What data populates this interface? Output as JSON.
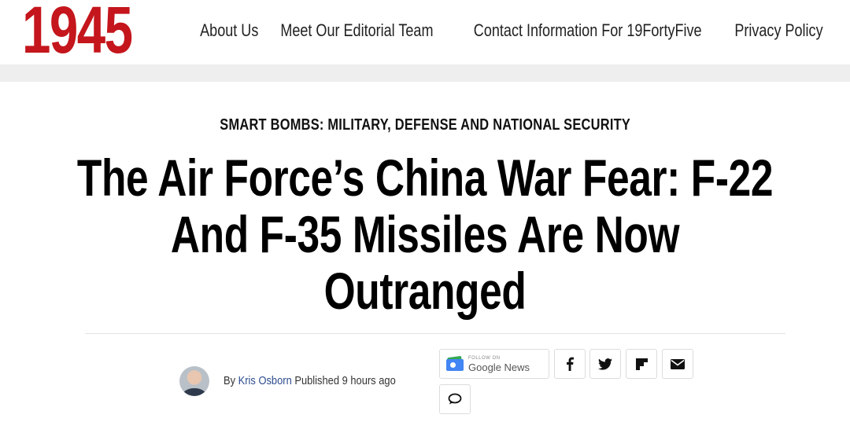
{
  "site": {
    "logo_text": "1945",
    "brand_color": "#c4161c"
  },
  "nav": {
    "items": [
      {
        "label": "About Us"
      },
      {
        "label": "Meet Our Editorial Team"
      },
      {
        "label": "Contact Information For 19FortyFive"
      },
      {
        "label": "Privacy Policy"
      }
    ]
  },
  "article": {
    "category": "SMART BOMBS: MILITARY, DEFENSE AND NATIONAL SECURITY",
    "title": "The Air Force’s China War Fear: F-22 And F-35 Missiles Are Now Outranged",
    "byline": {
      "prefix": "By",
      "author": "Kris Osborn",
      "published_label": "Published",
      "time_ago": "9 hours ago"
    }
  },
  "share": {
    "google_news": {
      "small_label": "FOLLOW ON",
      "label": "Google News"
    },
    "buttons": [
      {
        "icon": "facebook-icon"
      },
      {
        "icon": "twitter-icon"
      },
      {
        "icon": "flipboard-icon"
      },
      {
        "icon": "email-icon"
      },
      {
        "icon": "comment-icon"
      }
    ]
  },
  "colors": {
    "link": "#2d4c8f",
    "band": "#eeeeee"
  }
}
